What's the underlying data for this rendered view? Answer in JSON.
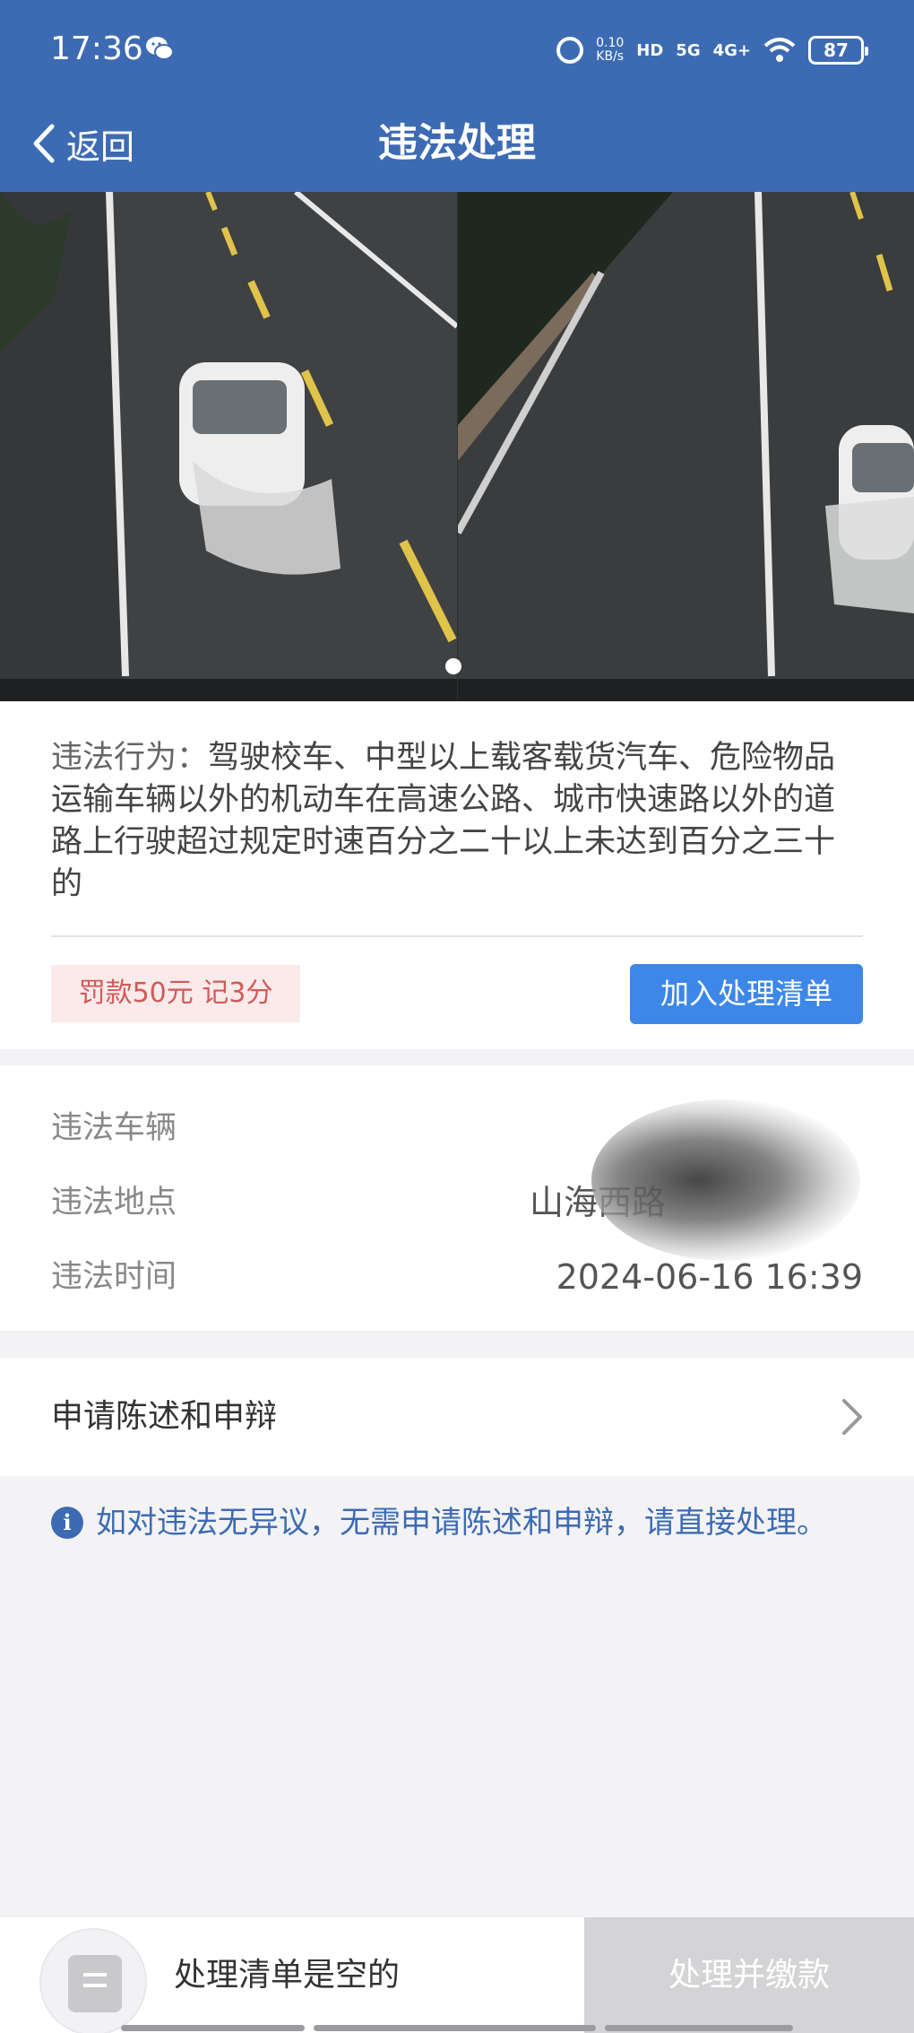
{
  "status_bar": {
    "time": "17:36",
    "network_speed_value": "0.10",
    "network_speed_unit": "KB/s",
    "hd_label": "HD",
    "signal_5g": "5G",
    "signal_4g": "4G+",
    "battery": "87",
    "icons": [
      "wechat-icon",
      "alarm-icon",
      "wifi-icon",
      "battery-icon"
    ]
  },
  "header": {
    "back_label": "返回",
    "title": "违法处理"
  },
  "violation": {
    "behavior_label": "违法行为：",
    "behavior_text": "驾驶校车、中型以上载客载货汽车、危险物品运输车辆以外的机动车在高速公路、城市快速路以外的道路上行驶超过规定时速百分之二十以上未达到百分之三十的",
    "penalty": "罚款50元 记3分",
    "add_button": "加入处理清单"
  },
  "details": {
    "vehicle_label": "违法车辆",
    "vehicle_value": "",
    "location_label": "违法地点",
    "location_value": "山海西路",
    "time_label": "违法时间",
    "time_value": "2024-06-16 16:39"
  },
  "statement": {
    "label": "申请陈述和申辩"
  },
  "notice": {
    "text": "如对违法无异议，无需申请陈述和申辩，请直接处理。"
  },
  "bottom_bar": {
    "cart_text": "处理清单是空的",
    "pay_button": "处理并缴款"
  },
  "colors": {
    "primary": "#3d6bb3",
    "button_blue": "#3d87e8",
    "penalty_red": "#d05a5a",
    "penalty_bg": "#fbeaea",
    "disabled": "#d4d4d6"
  }
}
